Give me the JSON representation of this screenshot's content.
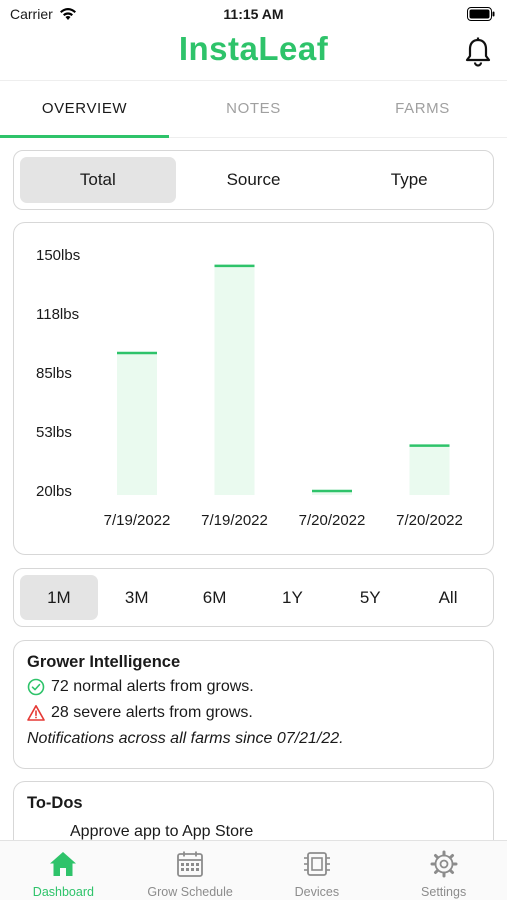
{
  "status_bar": {
    "carrier": "Carrier",
    "time": "11:15 AM"
  },
  "header": {
    "title": "InstaLeaf"
  },
  "tabs": [
    {
      "label": "OVERVIEW",
      "active": true
    },
    {
      "label": "NOTES",
      "active": false
    },
    {
      "label": "FARMS",
      "active": false
    }
  ],
  "breakdown_segment": {
    "options": [
      "Total",
      "Source",
      "Type"
    ],
    "selected": "Total"
  },
  "range_segment": {
    "options": [
      "1M",
      "3M",
      "6M",
      "1Y",
      "5Y",
      "All"
    ],
    "selected": "1M"
  },
  "chart_data": {
    "type": "bar",
    "categories": [
      "7/19/2022",
      "7/19/2022",
      "7/20/2022",
      "7/20/2022"
    ],
    "values": [
      96,
      144,
      20,
      45
    ],
    "yticks": [
      "150lbs",
      "118lbs",
      "85lbs",
      "53lbs",
      "20lbs"
    ],
    "ylim": [
      20,
      150
    ],
    "bar_color": "#eafaef",
    "line_color": "#2ec36a"
  },
  "grower_intelligence": {
    "title": "Grower Intelligence",
    "normal_alerts": "72 normal alerts from grows.",
    "severe_alerts": "28 severe alerts from grows.",
    "note": "Notifications across all farms since 07/21/22."
  },
  "todos": {
    "title": "To-Dos",
    "items": [
      "Approve app to App Store"
    ]
  },
  "bottom_nav": [
    {
      "label": "Dashboard",
      "icon": "home-icon",
      "active": true
    },
    {
      "label": "Grow Schedule",
      "icon": "calendar-icon",
      "active": false
    },
    {
      "label": "Devices",
      "icon": "chip-icon",
      "active": false
    },
    {
      "label": "Settings",
      "icon": "gear-icon",
      "active": false
    }
  ],
  "colors": {
    "accent": "#2ec36a",
    "severe": "#e53935",
    "border": "#d7d7d7"
  }
}
